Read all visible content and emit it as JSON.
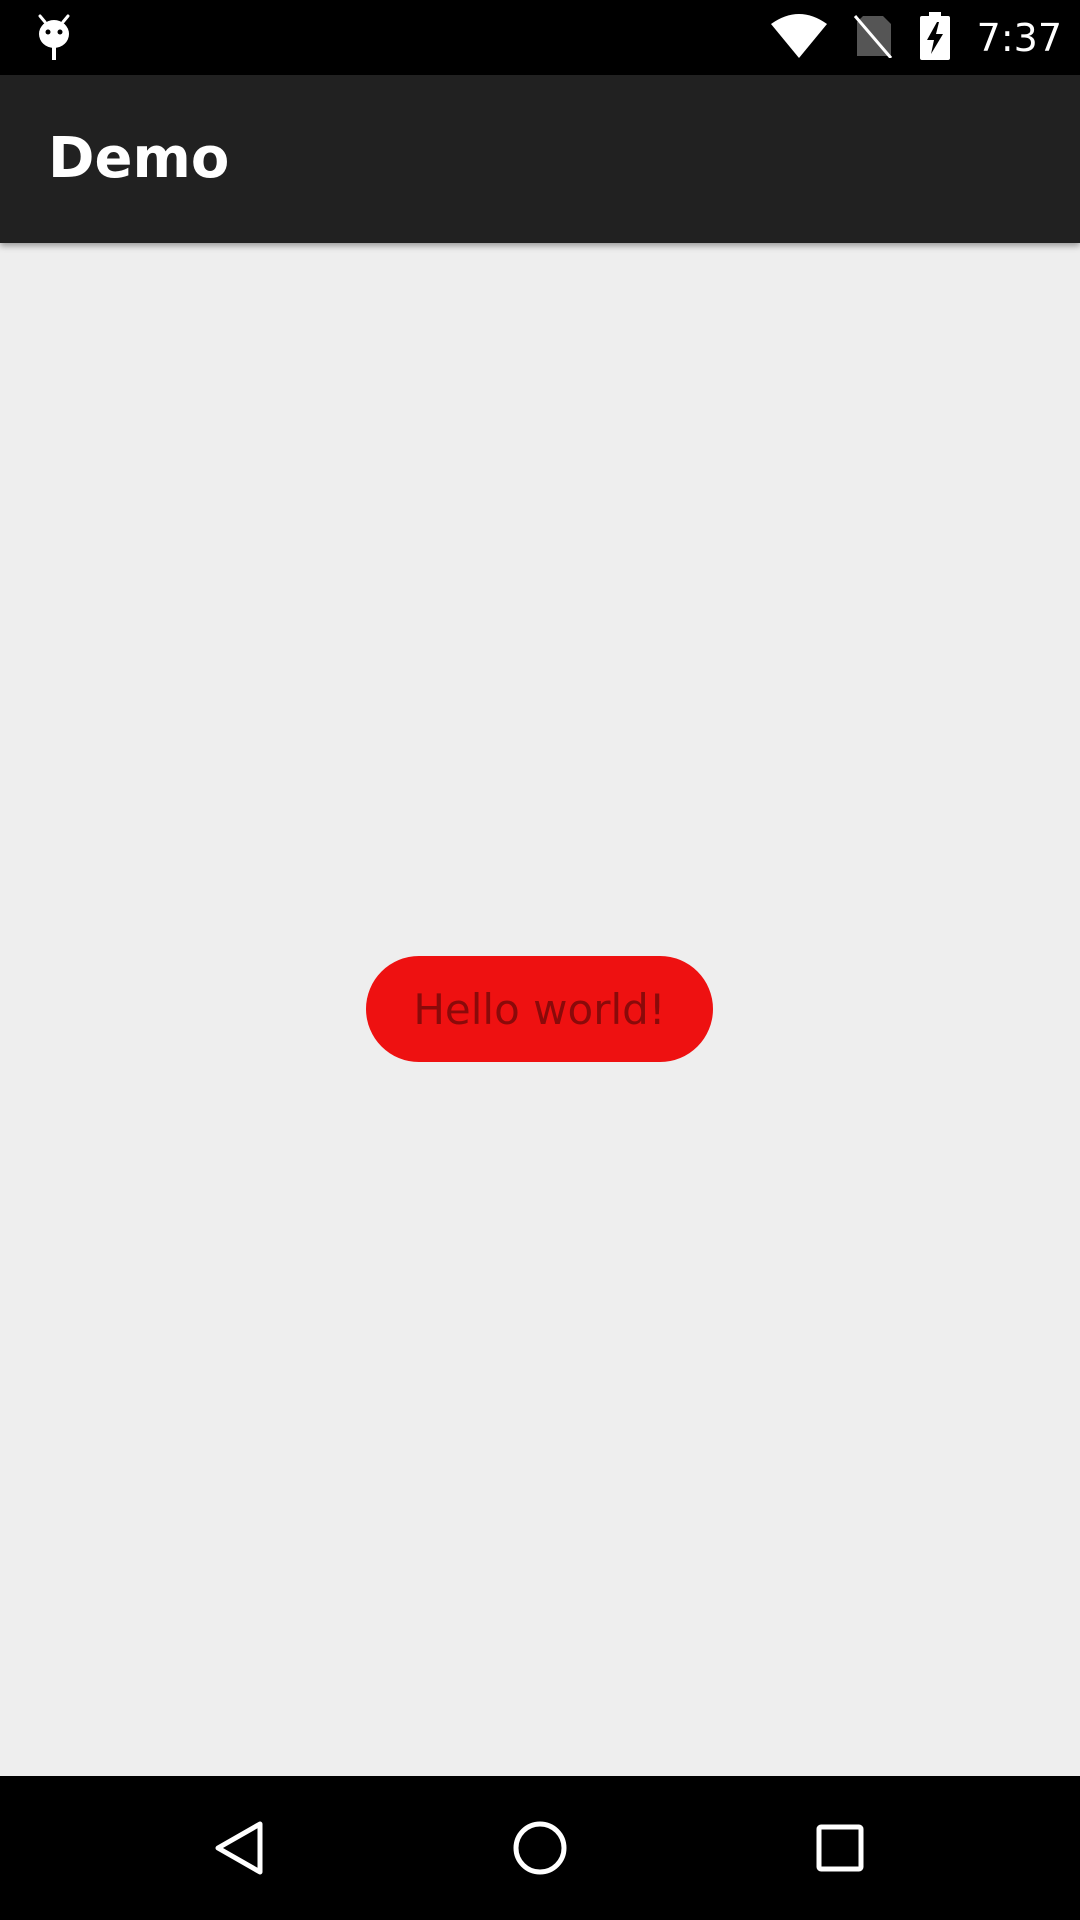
{
  "status_bar": {
    "time": "7:37",
    "left_icon": "android-debug-icon",
    "icons": [
      "wifi-icon",
      "no-sim-icon",
      "battery-charging-icon"
    ]
  },
  "app_bar": {
    "title": "Demo"
  },
  "main": {
    "button_label": "Hello world!"
  },
  "nav_bar": {
    "buttons": [
      "back-icon",
      "home-icon",
      "recents-icon"
    ]
  },
  "colors": {
    "status_bar": "#000000",
    "app_bar": "#212121",
    "background": "#eeeeee",
    "button": "#ee1111",
    "button_text": "#8a0a0a",
    "nav_bar": "#000000"
  }
}
